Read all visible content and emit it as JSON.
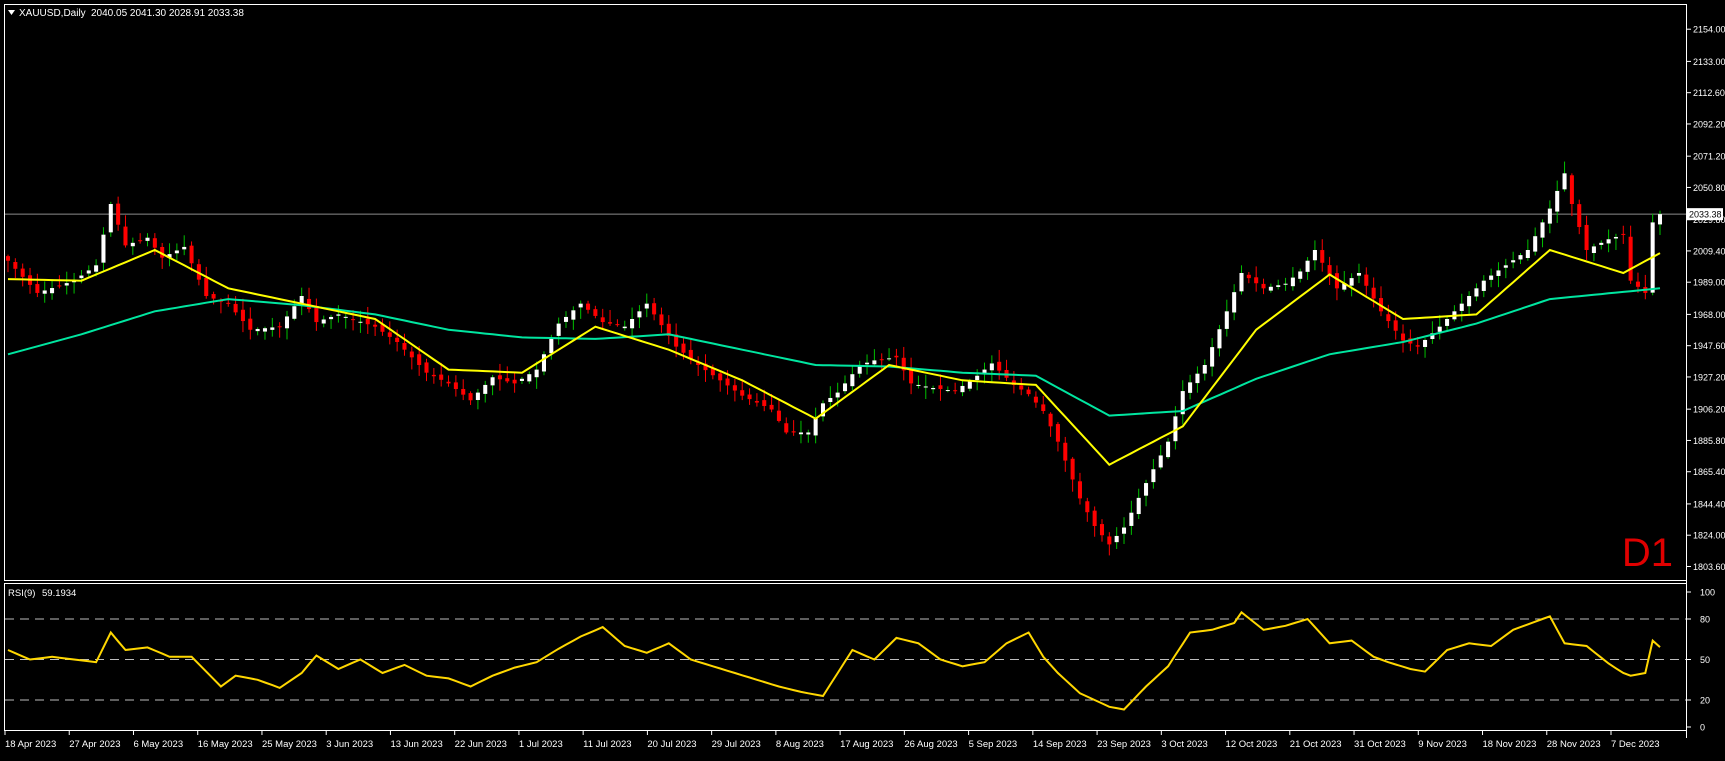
{
  "header": {
    "symbol_label": "XAUUSD,Daily",
    "ohlc": "2040.05 2041.30 2028.91 2033.38"
  },
  "timeframe_label": "D1",
  "rsi_header": {
    "label": "RSI(9)",
    "value": "59.1934"
  },
  "colors": {
    "background": "#000000",
    "frame": "#ffffff",
    "bull_candle": "#ffffff",
    "bear_candle": "#ff0000",
    "wick_bull": "#00c000",
    "wick_bear": "#ff0000",
    "ma_fast": "#ffff00",
    "ma_slow": "#00e6a0",
    "rsi_line": "#ffd700",
    "timeframe_label": "#e00000",
    "bid_line": "#8c8c8c"
  },
  "chart_data": [
    {
      "type": "candlestick",
      "title": "XAUUSD,Daily",
      "y_ticks": [
        "2154.00",
        "2133.00",
        "2112.60",
        "2092.20",
        "2071.20",
        "2050.80",
        "2029.80",
        "2009.40",
        "1989.00",
        "1968.00",
        "1947.60",
        "1927.20",
        "1906.20",
        "1885.80",
        "1865.40",
        "1844.40",
        "1824.00",
        "1803.60"
      ],
      "ylim": [
        1800,
        2160
      ],
      "last_price": 2033.38,
      "last_price_label": "2033.38",
      "x_ticks": [
        "18 Apr 2023",
        "27 Apr 2023",
        "6 May 2023",
        "16 May 2023",
        "25 May 2023",
        "3 Jun 2023",
        "13 Jun 2023",
        "22 Jun 2023",
        "1 Jul 2023",
        "11 Jul 2023",
        "20 Jul 2023",
        "29 Jul 2023",
        "8 Aug 2023",
        "17 Aug 2023",
        "26 Aug 2023",
        "5 Sep 2023",
        "14 Sep 2023",
        "23 Sep 2023",
        "3 Oct 2023",
        "12 Oct 2023",
        "21 Oct 2023",
        "31 Oct 2023",
        "9 Nov 2023",
        "18 Nov 2023",
        "28 Nov 2023",
        "7 Dec 2023"
      ],
      "close_anchors": [
        [
          0,
          2003
        ],
        [
          4,
          1982
        ],
        [
          9,
          1990
        ],
        [
          12,
          2000
        ],
        [
          14,
          2040
        ],
        [
          16,
          2013
        ],
        [
          19,
          2018
        ],
        [
          21,
          2005
        ],
        [
          24,
          2012
        ],
        [
          27,
          1980
        ],
        [
          30,
          1975
        ],
        [
          33,
          1958
        ],
        [
          37,
          1960
        ],
        [
          40,
          1980
        ],
        [
          42,
          1963
        ],
        [
          45,
          1968
        ],
        [
          50,
          1960
        ],
        [
          53,
          1950
        ],
        [
          57,
          1930
        ],
        [
          60,
          1923
        ],
        [
          63,
          1912
        ],
        [
          66,
          1927
        ],
        [
          69,
          1923
        ],
        [
          72,
          1932
        ],
        [
          75,
          1962
        ],
        [
          78,
          1975
        ],
        [
          81,
          1963
        ],
        [
          84,
          1960
        ],
        [
          87,
          1975
        ],
        [
          91,
          1947
        ],
        [
          94,
          1935
        ],
        [
          97,
          1925
        ],
        [
          100,
          1915
        ],
        [
          104,
          1906
        ],
        [
          106,
          1891
        ],
        [
          109,
          1891
        ],
        [
          111,
          1910
        ],
        [
          113,
          1917
        ],
        [
          116,
          1935
        ],
        [
          118,
          1938
        ],
        [
          121,
          1940
        ],
        [
          123,
          1923
        ],
        [
          126,
          1920
        ],
        [
          129,
          1918
        ],
        [
          132,
          1928
        ],
        [
          134,
          1936
        ],
        [
          137,
          1922
        ],
        [
          139,
          1916
        ],
        [
          141,
          1905
        ],
        [
          143,
          1885
        ],
        [
          146,
          1848
        ],
        [
          148,
          1830
        ],
        [
          150,
          1818
        ],
        [
          152,
          1829
        ],
        [
          155,
          1858
        ],
        [
          158,
          1885
        ],
        [
          160,
          1918
        ],
        [
          163,
          1935
        ],
        [
          166,
          1970
        ],
        [
          168,
          1995
        ],
        [
          171,
          1985
        ],
        [
          174,
          1988
        ],
        [
          176,
          1996
        ],
        [
          178,
          2010
        ],
        [
          181,
          1985
        ],
        [
          184,
          1995
        ],
        [
          187,
          1970
        ],
        [
          190,
          1951
        ],
        [
          192,
          1947
        ],
        [
          195,
          1960
        ],
        [
          198,
          1975
        ],
        [
          201,
          1990
        ],
        [
          204,
          2000
        ],
        [
          207,
          2010
        ],
        [
          210,
          2037
        ],
        [
          212,
          2060
        ],
        [
          213,
          2040
        ],
        [
          215,
          2010
        ],
        [
          218,
          2017
        ],
        [
          220,
          2020
        ],
        [
          221,
          1990
        ],
        [
          223,
          1982
        ],
        [
          224,
          2028
        ],
        [
          225,
          2033.38
        ]
      ],
      "series": [
        {
          "name": "Moving Average (fast)",
          "ma_period": 9,
          "anchors": [
            [
              0,
              1991
            ],
            [
              10,
              1990
            ],
            [
              20,
              2010
            ],
            [
              30,
              1985
            ],
            [
              40,
              1975
            ],
            [
              50,
              1965
            ],
            [
              60,
              1932
            ],
            [
              70,
              1930
            ],
            [
              80,
              1960
            ],
            [
              90,
              1945
            ],
            [
              100,
              1925
            ],
            [
              110,
              1900
            ],
            [
              120,
              1935
            ],
            [
              130,
              1925
            ],
            [
              140,
              1922
            ],
            [
              150,
              1870
            ],
            [
              160,
              1895
            ],
            [
              170,
              1958
            ],
            [
              180,
              1994
            ],
            [
              190,
              1965
            ],
            [
              200,
              1968
            ],
            [
              210,
              2010
            ],
            [
              220,
              1995
            ],
            [
              225,
              2008
            ]
          ]
        },
        {
          "name": "Moving Average (slow)",
          "ma_period": 40,
          "anchors": [
            [
              0,
              1942
            ],
            [
              10,
              1955
            ],
            [
              20,
              1970
            ],
            [
              30,
              1978
            ],
            [
              40,
              1974
            ],
            [
              50,
              1968
            ],
            [
              60,
              1958
            ],
            [
              70,
              1953
            ],
            [
              80,
              1952
            ],
            [
              90,
              1955
            ],
            [
              100,
              1945
            ],
            [
              110,
              1935
            ],
            [
              120,
              1934
            ],
            [
              130,
              1930
            ],
            [
              140,
              1928
            ],
            [
              150,
              1902
            ],
            [
              160,
              1905
            ],
            [
              170,
              1926
            ],
            [
              180,
              1942
            ],
            [
              190,
              1950
            ],
            [
              200,
              1962
            ],
            [
              210,
              1978
            ],
            [
              225,
              1985
            ]
          ]
        }
      ]
    },
    {
      "type": "line",
      "title": "RSI(9) 59.1934",
      "ylim": [
        0,
        100
      ],
      "y_ticks": [
        "100",
        "80",
        "50",
        "20",
        "0"
      ],
      "levels": [
        20,
        50,
        80
      ],
      "series": [
        {
          "name": "RSI(9)",
          "anchors": [
            [
              0,
              57
            ],
            [
              3,
              50
            ],
            [
              6,
              52
            ],
            [
              9,
              50
            ],
            [
              12,
              48
            ],
            [
              14,
              70
            ],
            [
              16,
              57
            ],
            [
              19,
              59
            ],
            [
              22,
              52
            ],
            [
              25,
              52
            ],
            [
              29,
              30
            ],
            [
              31,
              38
            ],
            [
              34,
              35
            ],
            [
              37,
              29
            ],
            [
              40,
              40
            ],
            [
              42,
              53
            ],
            [
              45,
              43
            ],
            [
              48,
              50
            ],
            [
              51,
              40
            ],
            [
              54,
              46
            ],
            [
              57,
              38
            ],
            [
              60,
              36
            ],
            [
              63,
              30
            ],
            [
              66,
              38
            ],
            [
              69,
              44
            ],
            [
              72,
              48
            ],
            [
              75,
              58
            ],
            [
              78,
              67
            ],
            [
              81,
              74
            ],
            [
              84,
              60
            ],
            [
              87,
              55
            ],
            [
              90,
              62
            ],
            [
              93,
              50
            ],
            [
              96,
              45
            ],
            [
              99,
              40
            ],
            [
              102,
              35
            ],
            [
              105,
              30
            ],
            [
              108,
              26
            ],
            [
              110,
              24
            ],
            [
              111,
              23
            ],
            [
              113,
              40
            ],
            [
              115,
              57
            ],
            [
              118,
              50
            ],
            [
              121,
              66
            ],
            [
              124,
              62
            ],
            [
              127,
              50
            ],
            [
              130,
              45
            ],
            [
              133,
              48
            ],
            [
              136,
              62
            ],
            [
              139,
              70
            ],
            [
              141,
              52
            ],
            [
              143,
              40
            ],
            [
              146,
              25
            ],
            [
              150,
              15
            ],
            [
              152,
              13
            ],
            [
              155,
              30
            ],
            [
              158,
              45
            ],
            [
              161,
              70
            ],
            [
              164,
              72
            ],
            [
              167,
              77
            ],
            [
              168,
              85
            ],
            [
              171,
              72
            ],
            [
              174,
              75
            ],
            [
              177,
              80
            ],
            [
              180,
              62
            ],
            [
              183,
              64
            ],
            [
              186,
              52
            ],
            [
              188,
              48
            ],
            [
              191,
              43
            ],
            [
              193,
              41
            ],
            [
              196,
              57
            ],
            [
              199,
              62
            ],
            [
              202,
              60
            ],
            [
              205,
              72
            ],
            [
              208,
              78
            ],
            [
              210,
              82
            ],
            [
              212,
              62
            ],
            [
              215,
              60
            ],
            [
              218,
              47
            ],
            [
              220,
              40
            ],
            [
              221,
              38
            ],
            [
              223,
              40
            ],
            [
              224,
              64
            ],
            [
              225,
              59.19
            ]
          ]
        }
      ]
    }
  ]
}
